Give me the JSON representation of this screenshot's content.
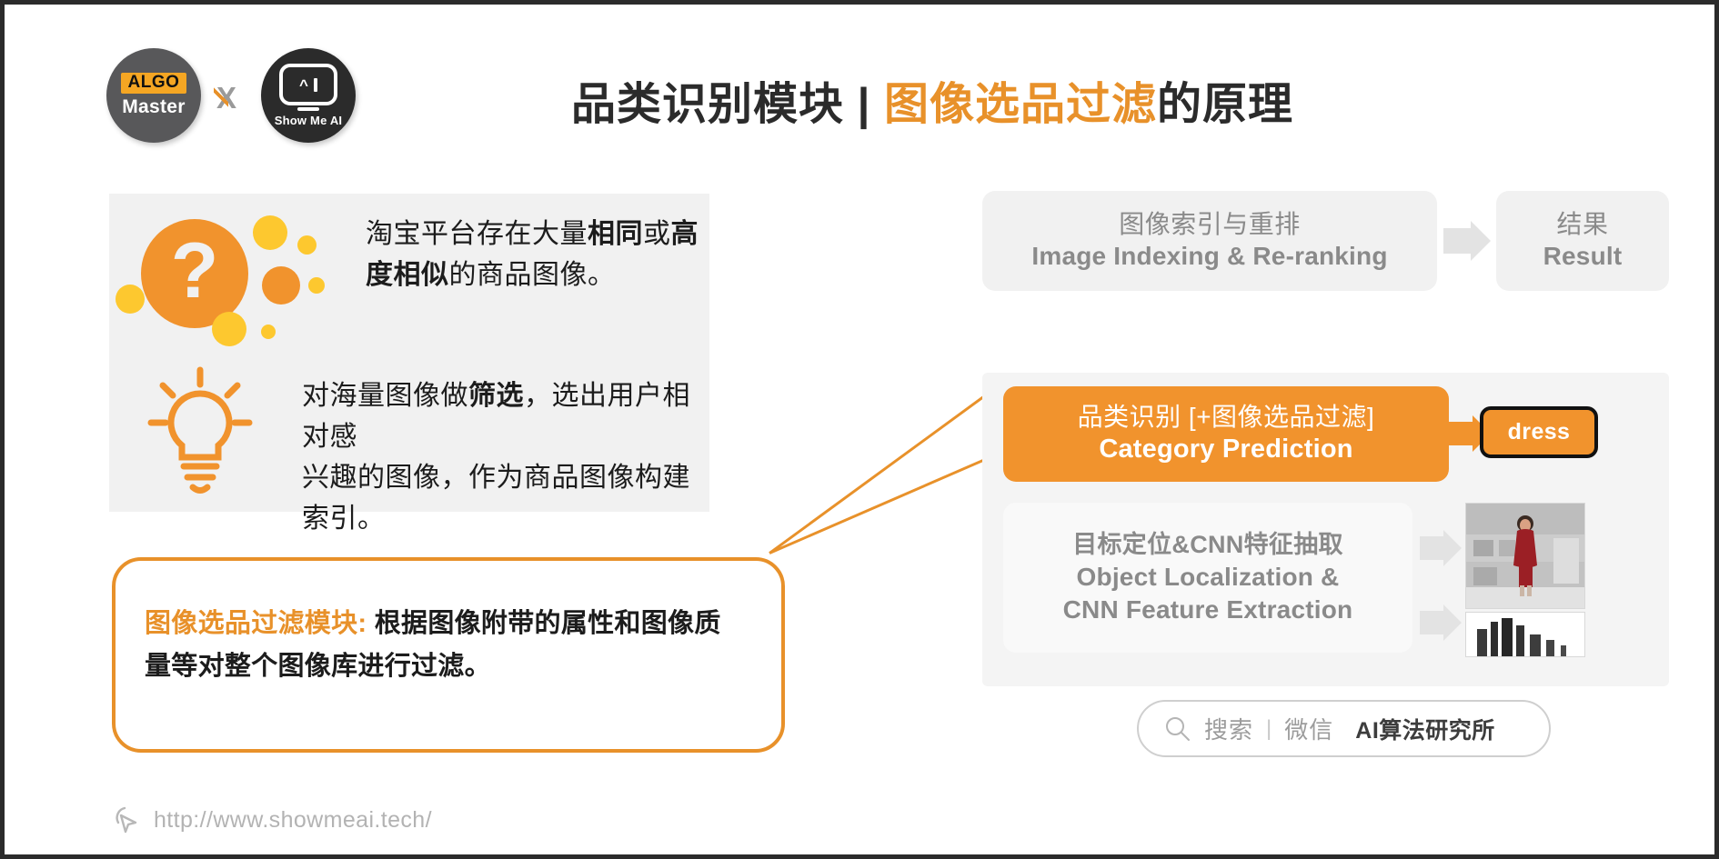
{
  "header": {
    "title_plain_1": "品类识别模块 | ",
    "title_highlight": "图像选品过滤",
    "title_plain_2": "的原理",
    "logo_left_top": "ALGO",
    "logo_left_bottom": "Master",
    "logo_separator": "X",
    "logo_right_text": "Show Me AI",
    "logo_right_caret": "^",
    "icons": {
      "algo_master": "algo-master-logo-icon",
      "show_me_ai": "show-me-ai-logo-icon"
    }
  },
  "left_panel": {
    "question_icon": "question-mark-icon",
    "bulb_icon": "lightbulb-icon",
    "paragraph1": {
      "part1": "淘宝平台存在大量",
      "bold1": "相同",
      "part2": "或",
      "bold2": "高",
      "line2_bold": "度相似",
      "line2_rest": "的商品图像。"
    },
    "paragraph2": {
      "part1": "对海量图像做",
      "bold1": "筛选",
      "part2": "，选出用户相对感",
      "line2": "兴趣的图像，作为商品图像构建索引。"
    }
  },
  "callout": {
    "highlight": "图像选品过滤模块: ",
    "line1_rest": "根据图像附带的属性和图像质",
    "line2": "量等对整个图像库进行过滤。"
  },
  "pipeline": {
    "top_box": {
      "cn": "图像索引与重排",
      "en": "Image Indexing & Re-ranking"
    },
    "result_box": {
      "cn": "结果",
      "en": "Result"
    },
    "category_box": {
      "cn": "品类识别 [+图像选品过滤]",
      "en": "Category Prediction"
    },
    "dress_label": "dress",
    "object_box": {
      "cn": "目标定位&CNN特征抽取",
      "en_line1": "Object Localization &",
      "en_line2": "CNN Feature Extraction"
    },
    "thumbnails": {
      "photo": "woman-in-red-dress-photo",
      "histogram": "feature-histogram-thumbnail"
    },
    "arrows": {
      "top_to_result": "arrow-right-icon",
      "category_to_dress": "arrow-right-icon",
      "object_to_photo": "arrow-right-icon",
      "object_to_histogram": "arrow-right-icon"
    }
  },
  "searchbar": {
    "icon": "search-icon",
    "placeholder": "搜索",
    "divider": "|",
    "channel": "微信",
    "brand": "AI算法研究所"
  },
  "footer": {
    "cursor_icon": "cursor-pointer-icon",
    "url": "http://www.showmeai.tech/"
  },
  "colors": {
    "accent_orange": "#f1932d",
    "title_orange": "#e8912a",
    "panel_gray": "#f1f1f1",
    "text_dark": "#1c1c1c",
    "muted_gray": "#8a8a8a"
  }
}
